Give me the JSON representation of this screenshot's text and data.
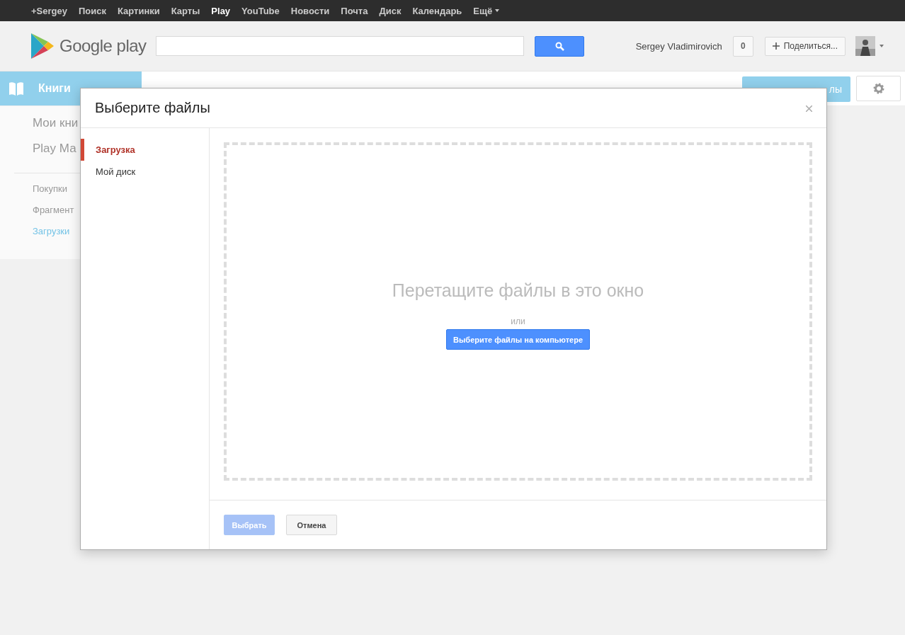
{
  "topbar": {
    "links": [
      {
        "label": "+Sergey",
        "selected": false
      },
      {
        "label": "Поиск",
        "selected": false
      },
      {
        "label": "Картинки",
        "selected": false
      },
      {
        "label": "Карты",
        "selected": false
      },
      {
        "label": "Play",
        "selected": true
      },
      {
        "label": "YouTube",
        "selected": false
      },
      {
        "label": "Новости",
        "selected": false
      },
      {
        "label": "Почта",
        "selected": false
      },
      {
        "label": "Диск",
        "selected": false
      },
      {
        "label": "Календарь",
        "selected": false
      }
    ],
    "more": "Ещё"
  },
  "header": {
    "logo": "Google play",
    "user": "Sergey Vladimirovich",
    "notifications": "0",
    "share": "Поделиться..."
  },
  "section": {
    "title": "Книги",
    "upload_button": "лы"
  },
  "sidebar": {
    "items": [
      "Мои кни",
      "Play Ма"
    ],
    "links": [
      {
        "label": "Покупки",
        "selected": false
      },
      {
        "label": "Фрагмент",
        "selected": false
      },
      {
        "label": "Загрузки",
        "selected": true
      }
    ]
  },
  "dialog": {
    "title": "Выберите файлы",
    "tabs": [
      {
        "label": "Загрузка",
        "selected": true
      },
      {
        "label": "Мой диск",
        "selected": false
      }
    ],
    "drop_text": "Перетащите файлы в это окно",
    "or": "или",
    "choose_button": "Выберите файлы на компьютере",
    "select_button": {
      "label": "Выбрать",
      "disabled": true
    },
    "cancel_button": "Отмена"
  }
}
